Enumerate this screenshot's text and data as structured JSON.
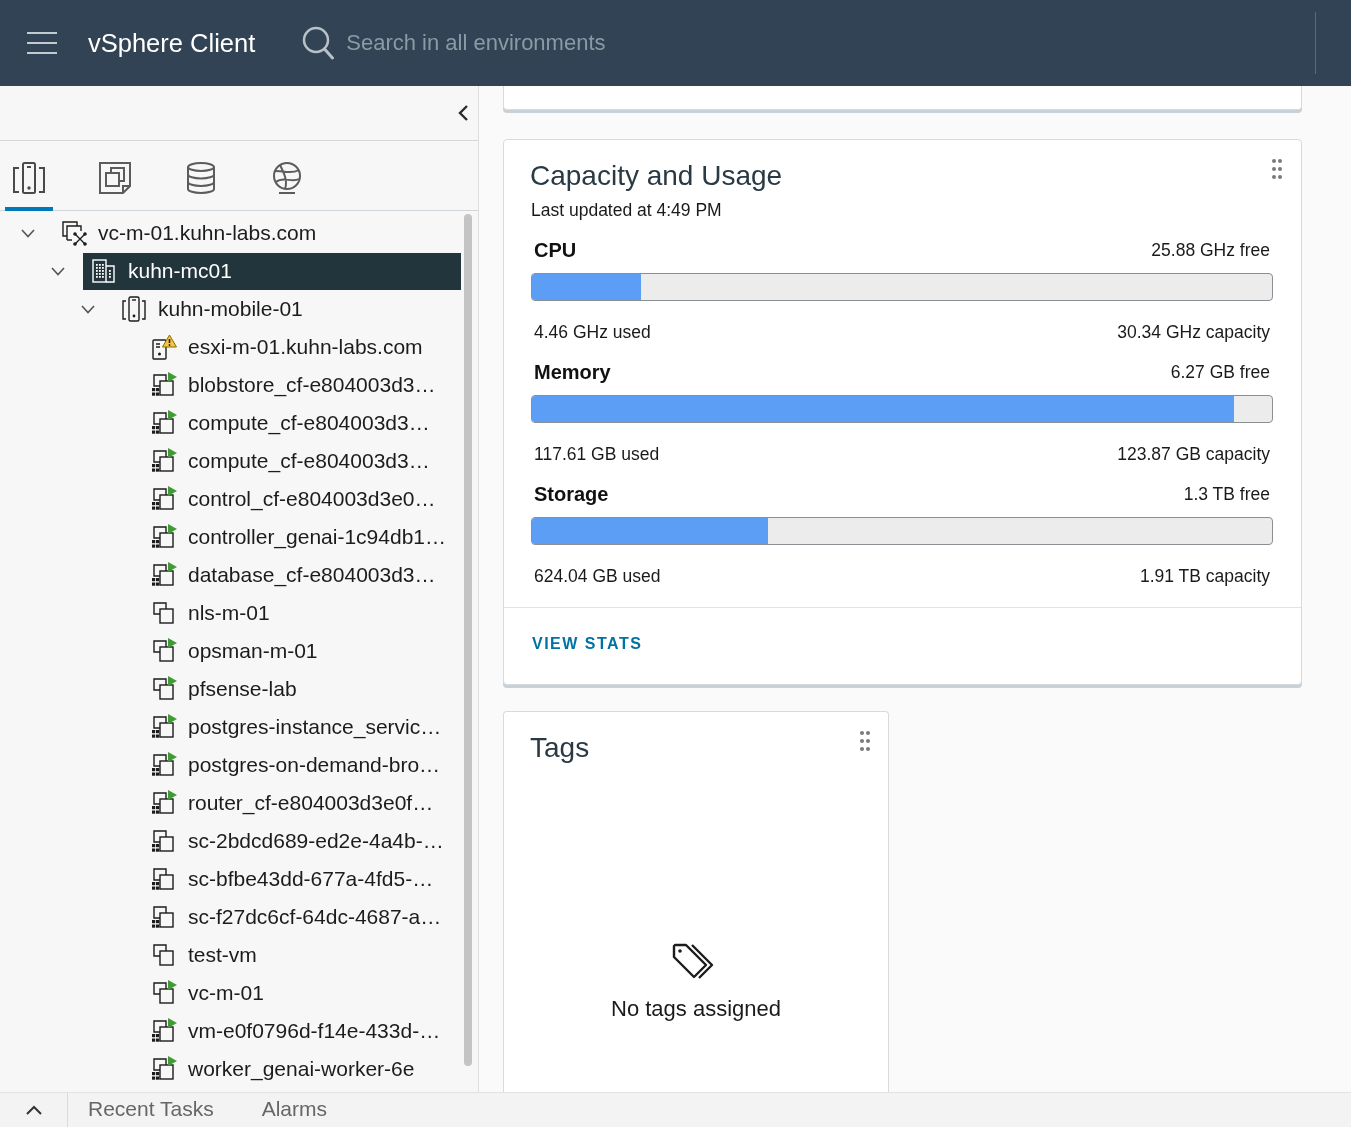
{
  "header": {
    "title": "vSphere Client",
    "search": {
      "placeholder": "Search in all environments"
    }
  },
  "sidebar": {
    "nav_tabs": [
      {
        "kind": "hosts",
        "selected": true
      },
      {
        "kind": "vms",
        "selected": false
      },
      {
        "kind": "storage",
        "selected": false
      },
      {
        "kind": "networks",
        "selected": false
      }
    ],
    "tree": [
      {
        "label": "vc-m-01.kuhn-labs.com",
        "kind": "vcenter",
        "expanded": true,
        "selected": false,
        "children": [
          {
            "label": "kuhn-mc01",
            "kind": "datacenter",
            "expanded": true,
            "selected": true,
            "children": [
              {
                "label": "kuhn-mobile-01",
                "kind": "cluster",
                "expanded": true,
                "selected": false,
                "children": [
                  {
                    "label": "esxi-m-01.kuhn-labs.com",
                    "kind": "host",
                    "warning": true,
                    "selected": false
                  },
                  {
                    "label": "blobstore_cf-e804003d3…",
                    "kind": "stackedvm",
                    "powered_on": true,
                    "selected": false
                  },
                  {
                    "label": "compute_cf-e804003d3…",
                    "kind": "stackedvm",
                    "powered_on": true,
                    "selected": false
                  },
                  {
                    "label": "compute_cf-e804003d3…",
                    "kind": "stackedvm",
                    "powered_on": true,
                    "selected": false
                  },
                  {
                    "label": "control_cf-e804003d3e0…",
                    "kind": "stackedvm",
                    "powered_on": true,
                    "selected": false
                  },
                  {
                    "label": "controller_genai-1c94db1…",
                    "kind": "stackedvm",
                    "powered_on": true,
                    "selected": false
                  },
                  {
                    "label": "database_cf-e804003d3…",
                    "kind": "stackedvm",
                    "powered_on": true,
                    "selected": false
                  },
                  {
                    "label": "nls-m-01",
                    "kind": "vm",
                    "powered_on": false,
                    "selected": false
                  },
                  {
                    "label": "opsman-m-01",
                    "kind": "vm",
                    "powered_on": true,
                    "selected": false
                  },
                  {
                    "label": "pfsense-lab",
                    "kind": "vm",
                    "powered_on": true,
                    "selected": false
                  },
                  {
                    "label": "postgres-instance_servic…",
                    "kind": "stackedvm",
                    "powered_on": true,
                    "selected": false
                  },
                  {
                    "label": "postgres-on-demand-bro…",
                    "kind": "stackedvm",
                    "powered_on": true,
                    "selected": false
                  },
                  {
                    "label": "router_cf-e804003d3e0f…",
                    "kind": "stackedvm",
                    "powered_on": true,
                    "selected": false
                  },
                  {
                    "label": "sc-2bdcd689-ed2e-4a4b-…",
                    "kind": "stackedvm",
                    "powered_on": false,
                    "selected": false
                  },
                  {
                    "label": "sc-bfbe43dd-677a-4fd5-…",
                    "kind": "stackedvm",
                    "powered_on": false,
                    "selected": false
                  },
                  {
                    "label": "sc-f27dc6cf-64dc-4687-a…",
                    "kind": "stackedvm",
                    "powered_on": false,
                    "selected": false
                  },
                  {
                    "label": "test-vm",
                    "kind": "vm",
                    "powered_on": false,
                    "selected": false
                  },
                  {
                    "label": "vc-m-01",
                    "kind": "vm",
                    "powered_on": true,
                    "selected": false
                  },
                  {
                    "label": "vm-e0f0796d-f14e-433d-…",
                    "kind": "stackedvm",
                    "powered_on": true,
                    "selected": false
                  },
                  {
                    "label": "worker_genai-worker-6e",
                    "kind": "stackedvm",
                    "powered_on": true,
                    "selected": false
                  }
                ]
              }
            ]
          }
        ]
      }
    ]
  },
  "capacity_card": {
    "title": "Capacity and Usage",
    "last_updated": "Last updated at 4:49 PM",
    "resources": [
      {
        "name": "CPU",
        "free": "25.88 GHz free",
        "level": 0.147,
        "used": "4.46 GHz used",
        "capacity": "30.34 GHz capacity"
      },
      {
        "name": "Memory",
        "free": "6.27 GB free",
        "level": 0.949,
        "used": "117.61 GB used",
        "capacity": "123.87 GB capacity"
      },
      {
        "name": "Storage",
        "free": "1.3 TB free",
        "level": 0.319,
        "used": "624.04 GB used",
        "capacity": "1.91 TB capacity"
      }
    ],
    "link": "VIEW STATS"
  },
  "tags_card": {
    "title": "Tags",
    "empty_text": "No tags assigned"
  },
  "bottom_bar": {
    "tabs": [
      {
        "label": "Recent Tasks",
        "selected": false
      },
      {
        "label": "Alarms",
        "selected": false
      }
    ]
  }
}
